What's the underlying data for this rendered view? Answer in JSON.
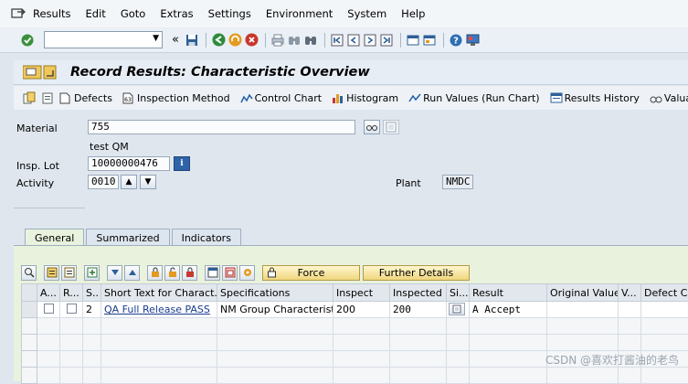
{
  "menu": [
    "Results",
    "Edit",
    "Goto",
    "Extras",
    "Settings",
    "Environment",
    "System",
    "Help"
  ],
  "screen_title": "Record Results: Characteristic Overview",
  "app_toolbar": [
    "Defects",
    "Inspection Method",
    "Control Chart",
    "Histogram",
    "Run Values (Run Chart)",
    "Results History",
    "Valuati"
  ],
  "header": {
    "material_label": "Material",
    "material_value": "755",
    "material_desc": "test QM",
    "insp_lot_label": "Insp. Lot",
    "insp_lot_value": "10000000476",
    "activity_label": "Activity",
    "activity_value": "0010",
    "plant_label": "Plant",
    "plant_value": "NMDC"
  },
  "tabs": [
    "General",
    "Summarized",
    "Indicators"
  ],
  "grid_buttons": {
    "force": "Force",
    "further": "Further Details"
  },
  "grid": {
    "columns": [
      "A...",
      "R...",
      "S..",
      "Short Text for Charact...",
      "Specifications",
      "Inspect",
      "Inspected",
      "Si...",
      "Result",
      "Original Value",
      "V...",
      "Defect Cl..."
    ],
    "row": {
      "seq": "2",
      "short_text": "QA Full Release PASS",
      "specifications": "NM Group Characteristic ...",
      "inspect": "200",
      "inspected": "200",
      "result": "A Accept"
    }
  },
  "watermark": "CSDN @喜欢打酱油的老鸟"
}
